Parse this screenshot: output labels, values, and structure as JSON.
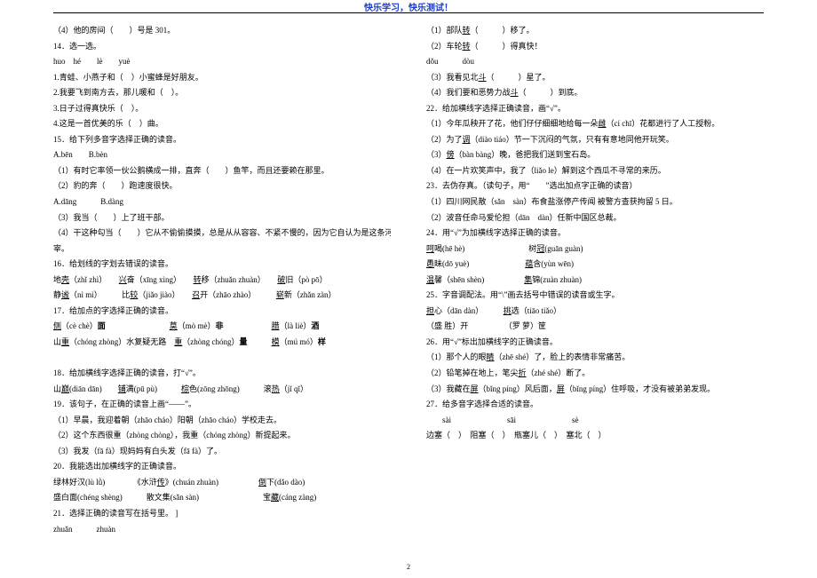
{
  "header": "快乐学习，快乐测试！",
  "page_number": "2",
  "lines": [
    {
      "t": "（4）他的房间（　　）号是 301。"
    },
    {
      "t": "14．选一选。"
    },
    {
      "t": "huo　hé　　lè　　yuè"
    },
    {
      "t": "1.青蛙、小燕子和（　）小蜜蜂是好朋友。"
    },
    {
      "t": "2.我要飞到南方去，那儿暖和（　）。"
    },
    {
      "t": "3.日子过得真快乐（　）。"
    },
    {
      "t": "4.这是一首优美的乐（　）曲。"
    },
    {
      "t": "15．给下列多音字选择正确的读音。"
    },
    {
      "t": "A.bēn　　B.bèn"
    },
    {
      "t": "（1）有时它率领一伙公鹅横成一排，直奔（　　）鱼竿，而且还要赖在那里。"
    },
    {
      "t": "（2）豹的奔（　　）跑速度很快。"
    },
    {
      "t": "A.dāng　　　B.dàng"
    },
    {
      "t": "（3）我当（　　）上了班干部。"
    },
    {
      "t": "（4）干这种勾当（　　）它从不偷偷摸摸，总是从从容容、不紧不慢的，因为它自认为是这条河的主"
    },
    {
      "t": "宰。"
    },
    {
      "t": "16．给划线的字划去错误的读音。"
    },
    {
      "t": "地<span class='u'>壳</span>（zhǐ zhì）　　<span class='u'>兴</span>奋（xīng xìng）　　<span class='u'>转</span>移（zhuǎn zhuàn）　　<span class='u'>破</span>旧（pò pō）"
    },
    {
      "t": "静<span class='u'>谧</span>（nì mì）　　　比<span class='u'>较</span>（jiǎo jiào）　　<span class='u'>召</span>开（zhāo zhào）　　　<span class='u'>崭</span>新（zhǎn zàn）"
    },
    {
      "t": "17．给加点的字选择正确的读音。"
    },
    {
      "t": "<span class='u'>侧</span>（cè chè）<b>面</b>　　　　　　　　<span class='u'>莫</span>（mò mè）<b>非</b>　　　　　　<span class='u'>腊</span>（là liè）<b>酒</b>"
    },
    {
      "t": "山<span class='u'>重</span>（chóng zhòng）水复疑无路　<span class='u'>重</span>（zhòng chóng）<b>量</b>　　　<span class='u'>模</span>（mú mó）<b>样</b>"
    },
    {
      "t": "　"
    },
    {
      "t": "18．给加横线字选择正确的读音，打“√”。"
    },
    {
      "t": "山<span class='u'>巅</span>(diān dān)　　<span class='u'>铺</span>满(pū pù)　　　<span class='u'>棕</span>色(zōng zhōng)　　　滚<span class='u'>热</span>（jǐ qǐ）"
    },
    {
      "t": "19．该句子，在正确的读音上画“——”。"
    },
    {
      "t": "（1）早晨，我迎着朝（zhāo cháo）阳朝（zhāo cháo）学校走去。"
    },
    {
      "t": "（2）这个东西很重（zhòng chòng），我重（chóng zhòng）新提起来。"
    },
    {
      "t": "（3）我发（fā fà）现妈妈有白头发（fā fà）了。"
    },
    {
      "t": "20．我能选出加横线字的正确读音。"
    },
    {
      "t": "绿林好汉(lù lǜ)　　　　《水浒<span class='u'>传</span>》(chuán zhuàn)　　　　　<span class='u'>倒</span>下(dǎo dào)"
    },
    {
      "t": "盛白面(chéng shèng)　　　散文集(sǎn sàn)　　　　　　　　宝<span class='u'>藏</span>(cáng zàng)"
    },
    {
      "t": "21．选择正确的读音写在括号里。 ]"
    },
    {
      "t": "zhuǎn　　　zhuàn"
    },
    {
      "t": "（1）部队<span class='u'>转</span>（　　　）移了。"
    },
    {
      "t": "（2）车轮<span class='u'>转</span>（　　　）得真快！"
    },
    {
      "t": "dǒu　　　dòu"
    },
    {
      "t": "（3）我看见北<span class='u'>斗</span>（　　　）星了。"
    },
    {
      "t": "（4）我们要和恶势力战<span class='u'>斗</span>（　　　）到底。"
    },
    {
      "t": "22．给加横线字选择正确读音，画“√”。"
    },
    {
      "t": "（1）今年瓜秧开了花，他们仔仔细细地给每一朵<span class='u'>雌</span>（cí chī）花都进行了人工授粉。"
    },
    {
      "t": "（2）为了<span class='u'>调</span>（diào tiáo）节一下沉闷的气氛，只有有意地同他开玩笑。"
    },
    {
      "t": "（3）<span class='u'>傍</span>（bàn bàng）晚，爸把我们送到宝石岛。"
    },
    {
      "t": "（4）在一片欢笑声中，我了（liǎo le）解到这个西瓜不寻常的来历。"
    },
    {
      "t": "23．去伪存真。（读句子，用“　　”选出加点字正确的读音）"
    },
    {
      "t": "（1）四川网民散（sǎn　sàn）布食盐涨停产传闻 被警方查获拘留 5 日。"
    },
    {
      "t": "（2）波音任命马爱伦担（dān　dàn）任新中国区总裁。"
    },
    {
      "t": "24．用“√”为加横线字选择正确的读音。"
    },
    {
      "t": "<span class='u'>呵</span>喝(hē hè)　　　　　　　　树<span class='u'>冠</span>(guān guàn)"
    },
    {
      "t": "<span class='u'>愚</span>昧(dō yuè)　　　　　　　<span class='u'>蕴</span>含(yùn wēn)"
    },
    {
      "t": "<span class='u'>温</span>馨（shēn shèn)　　　　　<span class='u'>集</span>锦(zuàn zhuàn)"
    },
    {
      "t": "25．字音调配法。用“\\”画去括号中错误的读音或生字。"
    },
    {
      "t": "<span class='u'>担</span>心（dān dàn）　　　<span class='u'>挑</span>选（tiāo tiǎo）"
    },
    {
      "t": "（盛 胜）开　　　　　（罗 萝）筐"
    },
    {
      "t": "26．用“√”标出加横线字的正确读音。"
    },
    {
      "t": "（1）那个人的眼<span class='u'>睛</span>（zhē shé）了，脸上的表情非常痛苦。"
    },
    {
      "t": "（2）铅笔掉在地上，笔尖<span class='u'>折</span>（zhé shé）断了。"
    },
    {
      "t": "（3）我藏在<span class='u'>屏</span>（bǐng píng）风后面，<span class='u'>屏</span>（bǐng píng）住呼吸，才没有被弟弟发现。"
    },
    {
      "t": "27．给多音字选择合适的读音。"
    },
    {
      "t": "　　sài　　　　　　　sāi　　　　　　　sè"
    },
    {
      "t": "边塞（　）　阻塞（　）　瓶塞儿（　）　塞北（　）"
    }
  ]
}
